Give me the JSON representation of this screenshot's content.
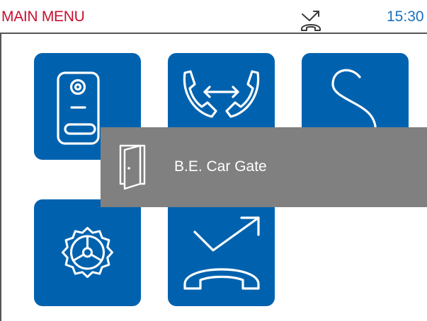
{
  "status_bar": {
    "title": "MAIN MENU",
    "time": "15:30",
    "status_icon": "missed-call-icon"
  },
  "menu": {
    "tiles": [
      {
        "icon": "door-station-icon"
      },
      {
        "icon": "call-transfer-icon"
      },
      {
        "icon": "s-shortcut-icon"
      },
      {
        "icon": "settings-gear-icon"
      },
      {
        "icon": "missed-calls-icon"
      }
    ]
  },
  "popup": {
    "icon": "door-icon",
    "label": "B.E. Car Gate"
  },
  "colors": {
    "title_red": "#c8102e",
    "time_blue": "#1a6fc1",
    "tile_blue": "#0062ae",
    "popup_gray": "#808080"
  }
}
